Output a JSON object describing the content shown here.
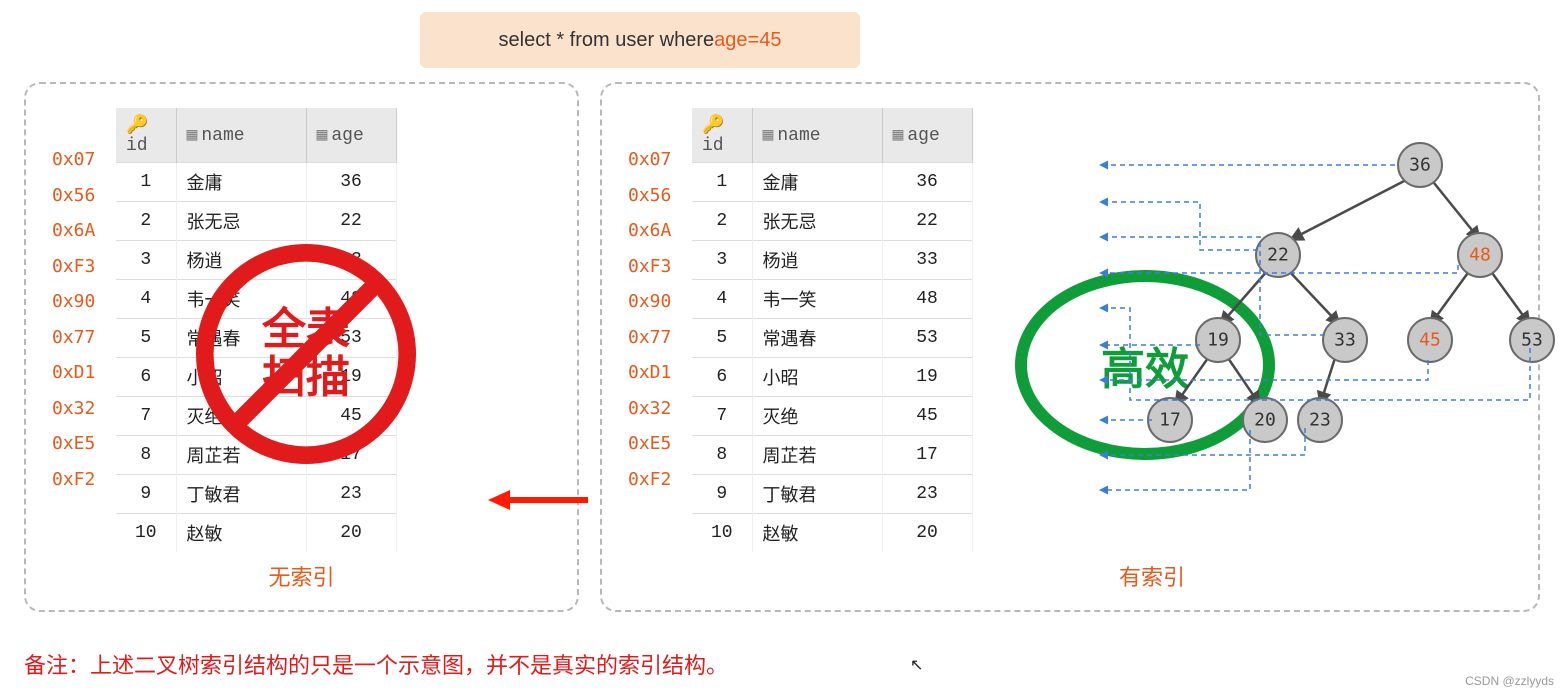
{
  "sql": {
    "prefix": "select * from user where ",
    "cond_field": "age",
    "cond_op": " = ",
    "cond_val": "45"
  },
  "columns": {
    "id": "id",
    "name": "name",
    "age": "age"
  },
  "rows": [
    {
      "addr": "0x07",
      "id": "1",
      "name": "金庸",
      "age": "36"
    },
    {
      "addr": "0x56",
      "id": "2",
      "name": "张无忌",
      "age": "22"
    },
    {
      "addr": "0x6A",
      "id": "3",
      "name": "杨逍",
      "age": "33"
    },
    {
      "addr": "0xF3",
      "id": "4",
      "name": "韦一笑",
      "age": "48"
    },
    {
      "addr": "0x90",
      "id": "5",
      "name": "常遇春",
      "age": "53"
    },
    {
      "addr": "0x77",
      "id": "6",
      "name": "小昭",
      "age": "19"
    },
    {
      "addr": "0xD1",
      "id": "7",
      "name": "灭绝",
      "age": "45"
    },
    {
      "addr": "0x32",
      "id": "8",
      "name": "周芷若",
      "age": "17"
    },
    {
      "addr": "0xE5",
      "id": "9",
      "name": "丁敏君",
      "age": "23"
    },
    {
      "addr": "0xF2",
      "id": "10",
      "name": "赵敏",
      "age": "20"
    }
  ],
  "left": {
    "caption": "无索引",
    "overlay_line1": "全表",
    "overlay_line2": "扫描"
  },
  "right": {
    "caption": "有索引",
    "overlay": "高效"
  },
  "tree_nodes": {
    "n36": "36",
    "n22": "22",
    "n48": "48",
    "n19": "19",
    "n33": "33",
    "n45": "45",
    "n53": "53",
    "n17": "17",
    "n20": "20",
    "n23": "23"
  },
  "footnote": "备注：上述二叉树索引结构的只是一个示意图，并不是真实的索引结构。",
  "watermark": "CSDN @zzlyyds"
}
